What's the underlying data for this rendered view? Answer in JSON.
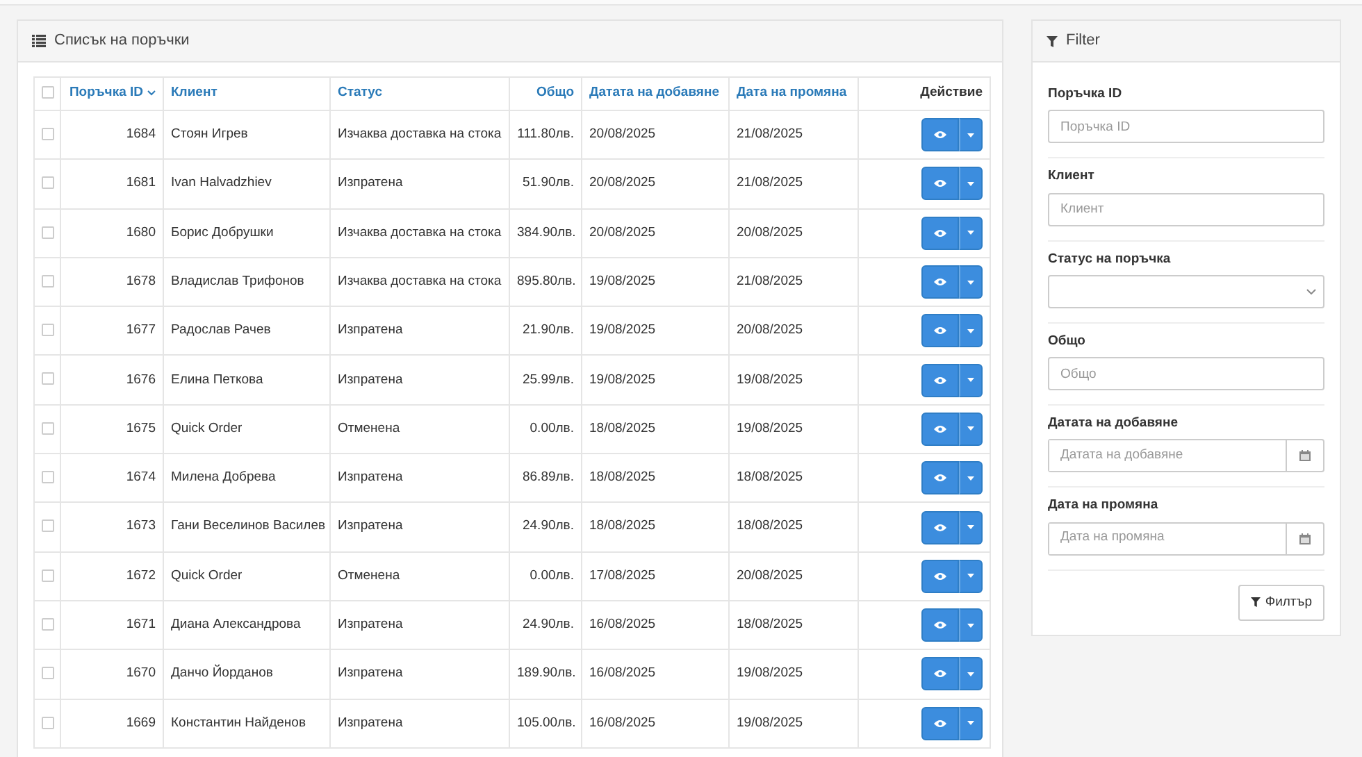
{
  "orders_panel": {
    "title": "Списък на поръчки",
    "columns": [
      {
        "label": "Поръчка ID",
        "link": true,
        "sorted": true
      },
      {
        "label": "Клиент",
        "link": true,
        "sorted": false
      },
      {
        "label": "Статус",
        "link": true,
        "sorted": false
      },
      {
        "label": "Общо",
        "link": true,
        "sorted": false
      },
      {
        "label": "Датата на добавяне",
        "link": true,
        "sorted": false
      },
      {
        "label": "Дата на промяна",
        "link": true,
        "sorted": false
      },
      {
        "label": "Действие",
        "link": false,
        "sorted": false
      }
    ],
    "select_all_checked": false,
    "rows": [
      {
        "checked": false,
        "cells": [
          "1684",
          "Стоян Игрев",
          "Изчаква доставка на стока",
          "111.80лв.",
          "20/08/2025",
          "21/08/2025"
        ]
      },
      {
        "checked": false,
        "cells": [
          "1681",
          "Ivan Halvadzhiev",
          "Изпратена",
          "51.90лв.",
          "20/08/2025",
          "21/08/2025"
        ]
      },
      {
        "checked": false,
        "cells": [
          "1680",
          "Борис Добрушки",
          "Изчаква доставка на стока",
          "384.90лв.",
          "20/08/2025",
          "20/08/2025"
        ]
      },
      {
        "checked": false,
        "cells": [
          "1678",
          "Владислав Трифонов",
          "Изчаква доставка на стока",
          "895.80лв.",
          "19/08/2025",
          "21/08/2025"
        ]
      },
      {
        "checked": false,
        "cells": [
          "1677",
          "Радослав Рачев",
          "Изпратена",
          "21.90лв.",
          "19/08/2025",
          "20/08/2025"
        ]
      },
      {
        "checked": false,
        "cells": [
          "1676",
          "Елина Петкова",
          "Изпратена",
          "25.99лв.",
          "19/08/2025",
          "19/08/2025"
        ]
      },
      {
        "checked": false,
        "cells": [
          "1675",
          "Quick Order",
          "Отменена",
          "0.00лв.",
          "18/08/2025",
          "19/08/2025"
        ]
      },
      {
        "checked": false,
        "cells": [
          "1674",
          "Милена Добрева",
          "Изпратена",
          "86.89лв.",
          "18/08/2025",
          "18/08/2025"
        ]
      },
      {
        "checked": false,
        "cells": [
          "1673",
          "Гани Веселинов Василев",
          "Изпратена",
          "24.90лв.",
          "18/08/2025",
          "18/08/2025"
        ]
      },
      {
        "checked": false,
        "cells": [
          "1672",
          "Quick Order",
          "Отменена",
          "0.00лв.",
          "17/08/2025",
          "20/08/2025"
        ]
      },
      {
        "checked": false,
        "cells": [
          "1671",
          "Диана Александрова",
          "Изпратена",
          "24.90лв.",
          "16/08/2025",
          "18/08/2025"
        ]
      },
      {
        "checked": false,
        "cells": [
          "1670",
          "Данчо Йорданов",
          "Изпратена",
          "189.90лв.",
          "16/08/2025",
          "19/08/2025"
        ]
      },
      {
        "checked": false,
        "cells": [
          "1669",
          "Константин Найденов",
          "Изпратена",
          "105.00лв.",
          "16/08/2025",
          "19/08/2025"
        ]
      }
    ]
  },
  "filter_panel": {
    "title": "Filter",
    "fields": [
      {
        "kind": "text",
        "label": "Поръчка ID",
        "placeholder": "Поръчка ID"
      },
      {
        "kind": "text",
        "label": "Клиент",
        "placeholder": "Клиент"
      },
      {
        "kind": "select",
        "label": "Статус на поръчка"
      },
      {
        "kind": "text",
        "label": "Общо",
        "placeholder": "Общо"
      },
      {
        "kind": "date",
        "label": "Датата на добавяне",
        "placeholder": "Датата на добавяне"
      },
      {
        "kind": "date",
        "label": "Дата на промяна",
        "placeholder": "Дата на промяна"
      }
    ],
    "button": "Филтър"
  }
}
